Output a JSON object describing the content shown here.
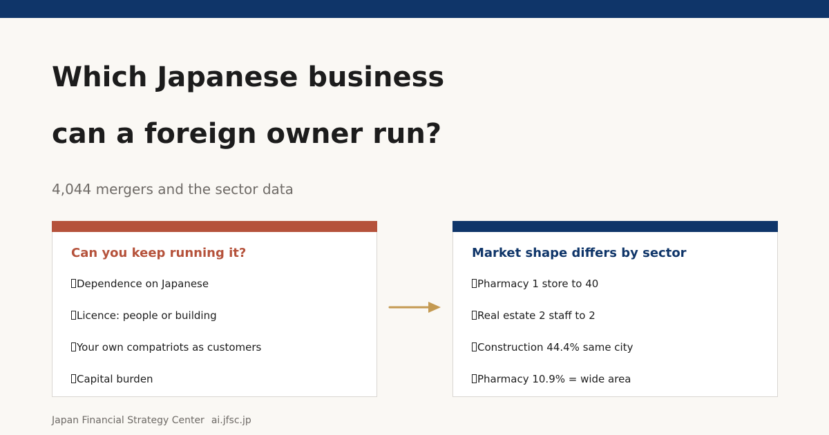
{
  "colors": {
    "navy": "#0f3569",
    "terracotta": "#b5523b",
    "gold": "#c49a52",
    "background": "#faf8f4"
  },
  "title": {
    "line1": "Which Japanese business",
    "line2": "can a foreign owner run?"
  },
  "subtitle": "4,044 mergers and the sector data",
  "left_card": {
    "heading": "Can you keep running it?",
    "items": [
      "Dependence on Japanese",
      "Licence: people or building",
      "Your own compatriots as customers",
      "Capital burden"
    ]
  },
  "connector": {
    "icon": "arrow-right-icon"
  },
  "right_card": {
    "heading": "Market shape differs by sector",
    "items": [
      "Pharmacy  1 store to 40",
      "Real estate  2 staff to 2",
      "Construction 44.4% same city",
      "Pharmacy 10.9% = wide area"
    ]
  },
  "footer": {
    "org": "Japan Financial Strategy Center",
    "domain": "ai.jfsc.jp"
  }
}
